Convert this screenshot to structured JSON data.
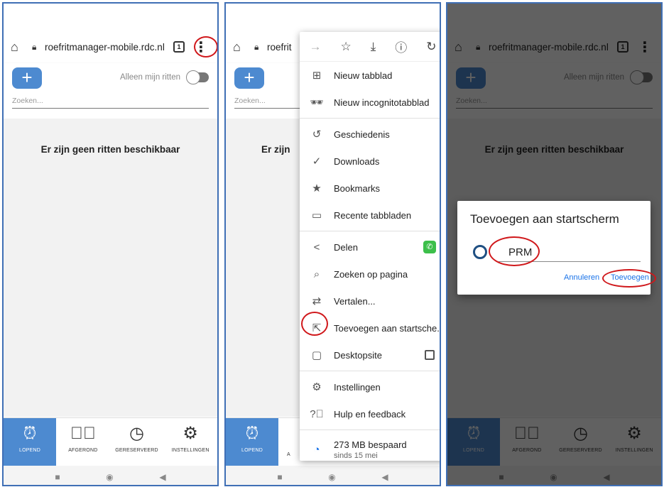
{
  "browser": {
    "url": "roefritmanager-mobile.rdc.nl",
    "url_truncated": "roefrit",
    "tab_count": "1"
  },
  "app": {
    "search_placeholder": "Zoeken...",
    "only_mine_label": "Alleen mijn ritten",
    "empty_message": "Er zijn geen ritten beschikbaar",
    "empty_message_truncated": "Er zijn",
    "nav": [
      {
        "label": "LOPEND",
        "icon": "alarm-clock-icon"
      },
      {
        "label": "AFGEROND",
        "icon": "check-circle-icon"
      },
      {
        "label": "GERESERVEERD",
        "icon": "clock-icon"
      },
      {
        "label": "INSTELLINGEN",
        "icon": "gear-icon"
      }
    ],
    "nav_truncated_label": "A"
  },
  "menu": {
    "items": [
      {
        "label": "Nieuw tabblad",
        "icon": "new-tab-icon"
      },
      {
        "label": "Nieuw incognitotabblad",
        "icon": "incognito-icon"
      },
      {
        "label": "Geschiedenis",
        "icon": "history-icon"
      },
      {
        "label": "Downloads",
        "icon": "download-done-icon"
      },
      {
        "label": "Bookmarks",
        "icon": "star-icon"
      },
      {
        "label": "Recente tabbladen",
        "icon": "devices-icon"
      },
      {
        "label": "Delen",
        "icon": "share-icon"
      },
      {
        "label": "Zoeken op pagina",
        "icon": "find-in-page-icon"
      },
      {
        "label": "Vertalen...",
        "icon": "translate-icon"
      },
      {
        "label": "Toevoegen aan startsche...",
        "icon": "add-to-home-icon"
      },
      {
        "label": "Desktopsite",
        "icon": "desktop-icon"
      },
      {
        "label": "Instellingen",
        "icon": "gear-icon"
      },
      {
        "label": "Hulp en feedback",
        "icon": "help-icon"
      }
    ],
    "saved_title": "273 MB bespaard",
    "saved_sub": "sinds 15 mei"
  },
  "dialog": {
    "title": "Toevoegen aan startscherm",
    "value": "PRM",
    "cancel": "Annuleren",
    "add": "Toevoegen"
  },
  "colors": {
    "accent": "#4d8ad0",
    "highlight_circle": "#d0181b",
    "link": "#1a73e8"
  }
}
